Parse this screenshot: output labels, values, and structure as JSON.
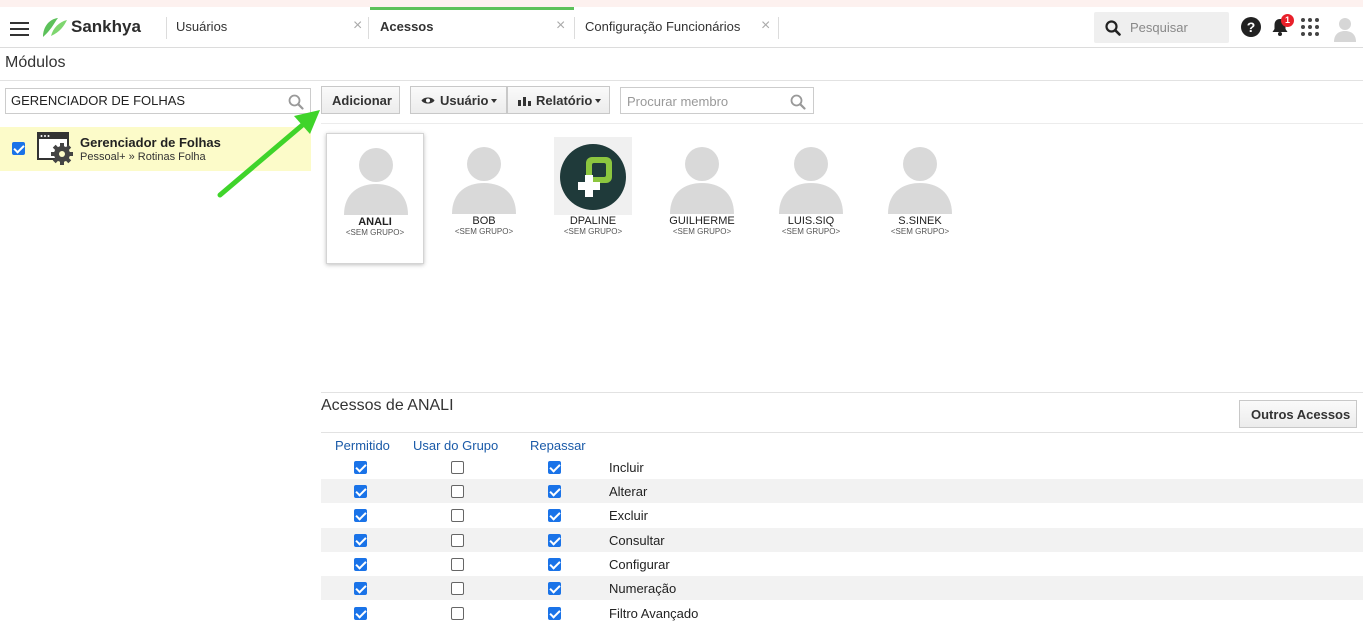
{
  "topbar": {
    "brand": "Sankhya",
    "tabs": [
      {
        "label": "Usuários",
        "active": false
      },
      {
        "label": "Acessos",
        "active": true
      },
      {
        "label": "Configuração Funcionários",
        "active": false
      }
    ],
    "close_glyph": "×",
    "search_placeholder": "Pesquisar",
    "help_glyph": "?",
    "notification_count": "1",
    "colors": {
      "active_tab": "#5cc15a",
      "brand": "#5cc15a",
      "badge": "#e8202a"
    }
  },
  "modules": {
    "title": "Módulos",
    "search_value": "GERENCIADOR DE FOLHAS",
    "items": [
      {
        "name": "Gerenciador de Folhas",
        "path": "Pessoal+ » Rotinas Folha",
        "checked": true
      }
    ]
  },
  "toolbar": {
    "add_label": "Adicionar",
    "user_label": "Usuário",
    "report_label": "Relatório",
    "member_search_placeholder": "Procurar membro"
  },
  "members": [
    {
      "name": "ANALI",
      "group": "<SEM GRUPO>",
      "selected": true,
      "avatar": "default-avatar-icon"
    },
    {
      "name": "BOB",
      "group": "<SEM GRUPO>",
      "selected": false,
      "avatar": "default-avatar-icon"
    },
    {
      "name": "DPALINE",
      "group": "<SEM GRUPO>",
      "selected": false,
      "avatar": "dpaline-logo-icon"
    },
    {
      "name": "GUILHERME",
      "group": "<SEM GRUPO>",
      "selected": false,
      "avatar": "default-avatar-icon"
    },
    {
      "name": "LUIS.SIQ",
      "group": "<SEM GRUPO>",
      "selected": false,
      "avatar": "default-avatar-icon"
    },
    {
      "name": "S.SINEK",
      "group": "<SEM GRUPO>",
      "selected": false,
      "avatar": "default-avatar-icon"
    }
  ],
  "access": {
    "title": "Acessos de ANALI",
    "other_access_label": "Outros Acessos",
    "columns": [
      "Permitido",
      "Usar do Grupo",
      "Repassar"
    ],
    "rows": [
      {
        "label": "Incluir",
        "permitido": true,
        "usar_do_grupo": false,
        "repassar": true
      },
      {
        "label": "Alterar",
        "permitido": true,
        "usar_do_grupo": false,
        "repassar": true
      },
      {
        "label": "Excluir",
        "permitido": true,
        "usar_do_grupo": false,
        "repassar": true
      },
      {
        "label": "Consultar",
        "permitido": true,
        "usar_do_grupo": false,
        "repassar": true
      },
      {
        "label": "Configurar",
        "permitido": true,
        "usar_do_grupo": false,
        "repassar": true
      },
      {
        "label": "Numeração",
        "permitido": true,
        "usar_do_grupo": false,
        "repassar": true
      },
      {
        "label": "Filtro Avançado",
        "permitido": true,
        "usar_do_grupo": false,
        "repassar": true
      }
    ]
  },
  "annotation": {
    "arrow_color": "#3fd42a",
    "points_to": "add-button"
  }
}
